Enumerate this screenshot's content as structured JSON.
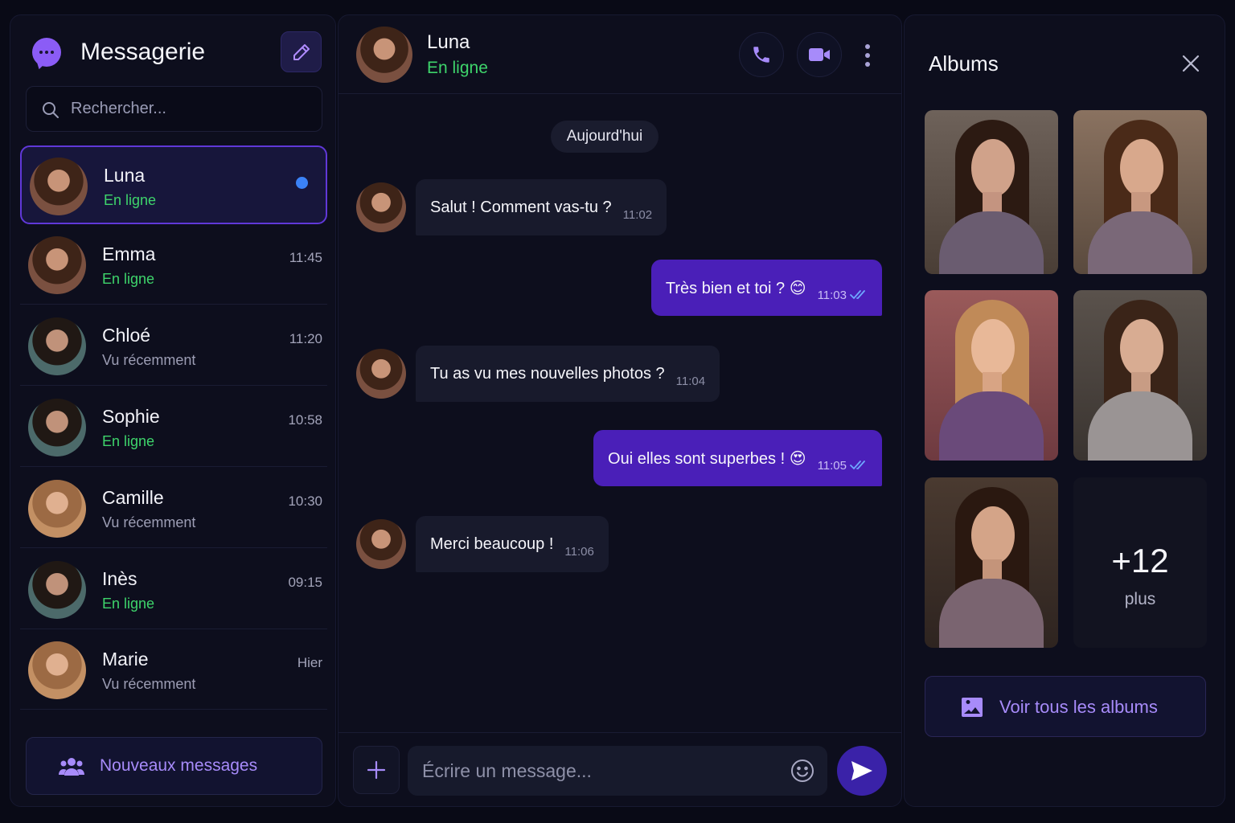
{
  "sidebar": {
    "title": "Messagerie",
    "search_placeholder": "Rechercher...",
    "contacts": [
      {
        "name": "Luna",
        "status": "En ligne",
        "time": "",
        "unread": true
      },
      {
        "name": "Emma",
        "status": "En ligne",
        "time": "11:45"
      },
      {
        "name": "Chloé",
        "status": "Vu récemment",
        "time": "11:20"
      },
      {
        "name": "Sophie",
        "status": "En ligne",
        "time": "10:58"
      },
      {
        "name": "Camille",
        "status": "Vu récemment",
        "time": "10:30"
      },
      {
        "name": "Inès",
        "status": "En ligne",
        "time": "09:15"
      },
      {
        "name": "Marie",
        "status": "Vu récemment",
        "time": "Hier"
      }
    ],
    "new_messages_label": "Nouveaux messages"
  },
  "chat": {
    "contact_name": "Luna",
    "contact_status": "En ligne",
    "date_label": "Aujourd'hui",
    "messages": [
      {
        "direction": "in",
        "text": "Salut ! Comment vas-tu ?",
        "time": "11:02"
      },
      {
        "direction": "out",
        "text": "Très bien et toi ? 😊",
        "time": "11:03",
        "read": true
      },
      {
        "direction": "in",
        "text": "Tu as vu mes nouvelles photos ?",
        "time": "11:04"
      },
      {
        "direction": "out",
        "text": "Oui elles sont superbes ! 😍",
        "time": "11:05",
        "read": true
      },
      {
        "direction": "in",
        "text": "Merci beaucoup !",
        "time": "11:06"
      }
    ],
    "input_placeholder": "Écrire un message..."
  },
  "albums": {
    "title": "Albums",
    "more_count": "+12",
    "more_label": "plus",
    "view_all_label": "Voir tous les albums"
  },
  "icons": [
    "chat-bubble-icon",
    "pencil-icon",
    "search-icon",
    "users-icon",
    "phone-icon",
    "video-icon",
    "more-vertical-icon",
    "double-check-icon",
    "plus-icon",
    "emoji-icon",
    "send-icon",
    "close-icon",
    "image-icon"
  ],
  "colors": {
    "accent": "#8b5cf6",
    "online": "#3ed46b",
    "unread": "#3b82f6",
    "outgoing_bubble": "#4a1fb8",
    "incoming_bubble": "#181a2c",
    "background": "#090a16"
  }
}
